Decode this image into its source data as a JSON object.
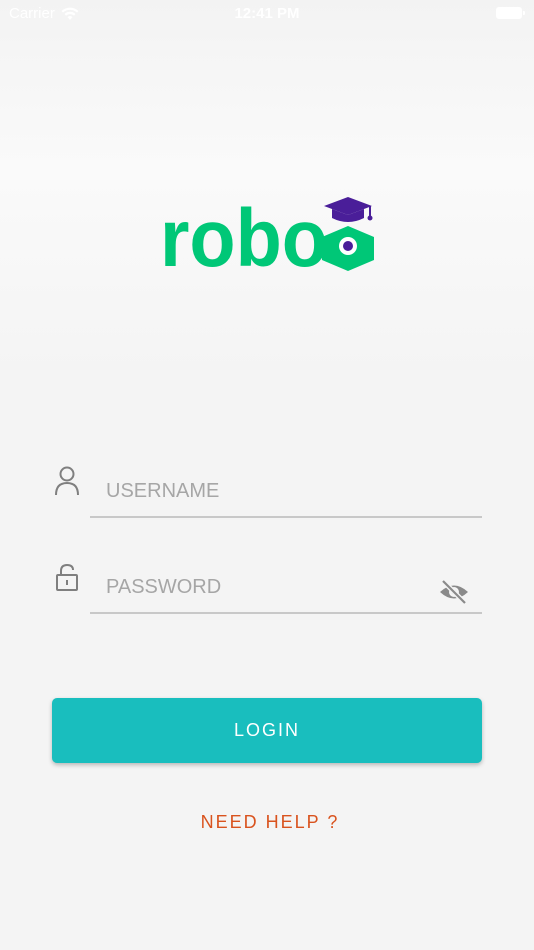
{
  "status_bar": {
    "carrier": "Carrier",
    "time": "12:41 PM"
  },
  "logo": {
    "text": "robo",
    "colors": {
      "text": "#00c777",
      "cap": "#4a1e99"
    }
  },
  "login_form": {
    "username_placeholder": "USERNAME",
    "password_placeholder": "PASSWORD",
    "login_label": "LOGIN",
    "help_label": "NEED HELP ?"
  },
  "colors": {
    "accent": "#19bebe",
    "help": "#d9531e",
    "icon": "#7f7f7f"
  },
  "icons": [
    "wifi-icon",
    "battery-icon",
    "user-icon",
    "lock-icon",
    "eye-off-icon"
  ]
}
